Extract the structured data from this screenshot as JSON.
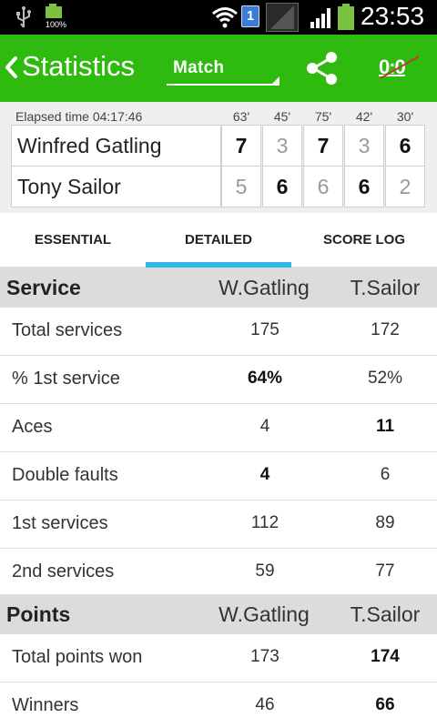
{
  "status_bar": {
    "battery_small_pct": "100%",
    "sim_label": "1",
    "time": "23:53",
    "icons": [
      "usb-icon",
      "battery-icon",
      "wifi-icon",
      "sim-icon",
      "no-signal-icon",
      "signal-icon",
      "battery-icon"
    ]
  },
  "action_bar": {
    "title": "Statistics",
    "selector_value": "Match",
    "reset_label": "0:0",
    "color": "#2fba10"
  },
  "score": {
    "elapsed": "Elapsed time 04:17:46",
    "set_times": [
      "63'",
      "45'",
      "75'",
      "42'",
      "30'"
    ],
    "players": [
      {
        "name": "Winfred Gatling",
        "games": [
          "7",
          "3",
          "7",
          "3",
          "6"
        ],
        "winner": [
          true,
          false,
          true,
          false,
          true
        ]
      },
      {
        "name": "Tony Sailor",
        "games": [
          "5",
          "6",
          "6",
          "6",
          "2"
        ],
        "winner": [
          false,
          true,
          false,
          true,
          false
        ]
      }
    ]
  },
  "tabs": {
    "items": [
      "ESSENTIAL",
      "DETAILED",
      "SCORE LOG"
    ],
    "active": "DETAILED",
    "indicator_color": "#33b5e5"
  },
  "stats": {
    "sections": [
      {
        "title": "Service",
        "col1": "W.Gatling",
        "col2": "T.Sailor",
        "rows": [
          {
            "label": "Total services",
            "v1": "175",
            "v2": "172",
            "bold1": false,
            "bold2": false
          },
          {
            "label": "% 1st service",
            "v1": "64%",
            "v2": "52%",
            "bold1": true,
            "bold2": false
          },
          {
            "label": "Aces",
            "v1": "4",
            "v2": "11",
            "bold1": false,
            "bold2": true
          },
          {
            "label": "Double faults",
            "v1": "4",
            "v2": "6",
            "bold1": true,
            "bold2": false
          },
          {
            "label": "1st services",
            "v1": "112",
            "v2": "89",
            "bold1": false,
            "bold2": false
          },
          {
            "label": "2nd services",
            "v1": "59",
            "v2": "77",
            "bold1": false,
            "bold2": false
          }
        ]
      },
      {
        "title": "Points",
        "col1": "W.Gatling",
        "col2": "T.Sailor",
        "rows": [
          {
            "label": "Total points won",
            "v1": "173",
            "v2": "174",
            "bold1": false,
            "bold2": true
          },
          {
            "label": "Winners",
            "v1": "46",
            "v2": "66",
            "bold1": false,
            "bold2": true
          }
        ]
      }
    ]
  }
}
